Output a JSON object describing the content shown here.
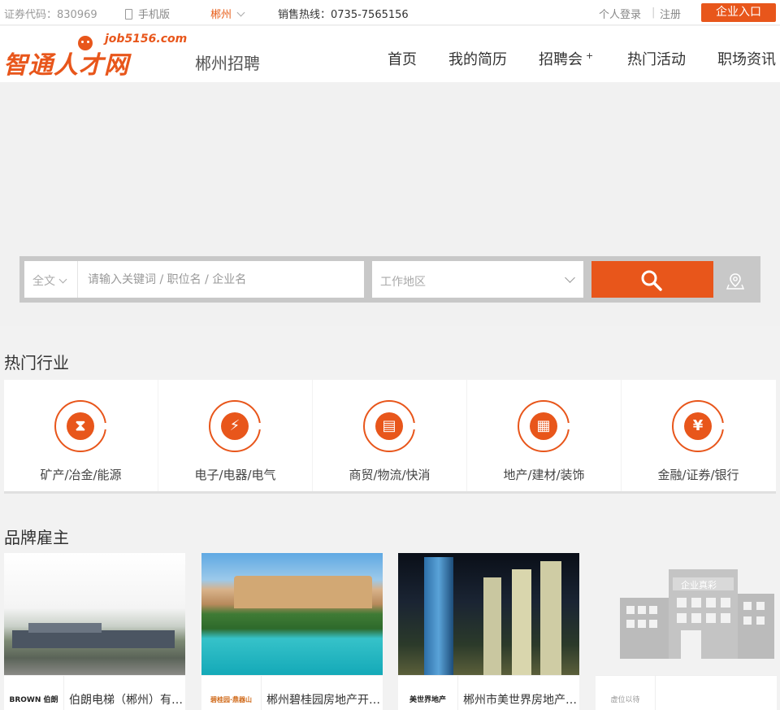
{
  "topbar": {
    "stock_code": "证券代码：830969",
    "mobile": "手机版",
    "city": "郴州",
    "hotline": "销售热线：0735-7565156",
    "login": "个人登录",
    "separator": "|",
    "register": "注册",
    "enterprise": "企业入口"
  },
  "header": {
    "logo_text": "智通人才网",
    "logo_domain": "job5156.com",
    "subtitle": "郴州招聘",
    "nav": [
      "首页",
      "我的简历",
      "招聘会",
      "热门活动",
      "职场资讯"
    ],
    "nav_plus": "+"
  },
  "search": {
    "scope": "全文",
    "keyword_placeholder": "请输入关键词 / 职位名 / 企业名",
    "area_placeholder": "工作地区"
  },
  "hot_industries": {
    "title": "热门行业",
    "items": [
      {
        "label": "矿产/冶金/能源",
        "icon": "hourglass-icon"
      },
      {
        "label": "电子/电器/电气",
        "icon": "electric-icon"
      },
      {
        "label": "商贸/物流/快消",
        "icon": "bus-icon"
      },
      {
        "label": "地产/建材/装饰",
        "icon": "building-icon"
      },
      {
        "label": "金融/证券/银行",
        "icon": "yen-icon"
      }
    ]
  },
  "brand_employers": {
    "title": "品牌雇主",
    "items": [
      {
        "name": "伯朗电梯（郴州）有限公司",
        "mini_logo": "BROWN 伯朗"
      },
      {
        "name": "郴州碧桂园房地产开发有限公司",
        "mini_logo": "碧桂园·鼎器山"
      },
      {
        "name": "郴州市美世界房地产开发有限公司",
        "mini_logo": "美世界地产"
      },
      {
        "name": "",
        "mini_logo": "虚位以待",
        "placeholder_label": "企业真彩"
      }
    ]
  },
  "colors": {
    "accent": "#e8561b"
  }
}
